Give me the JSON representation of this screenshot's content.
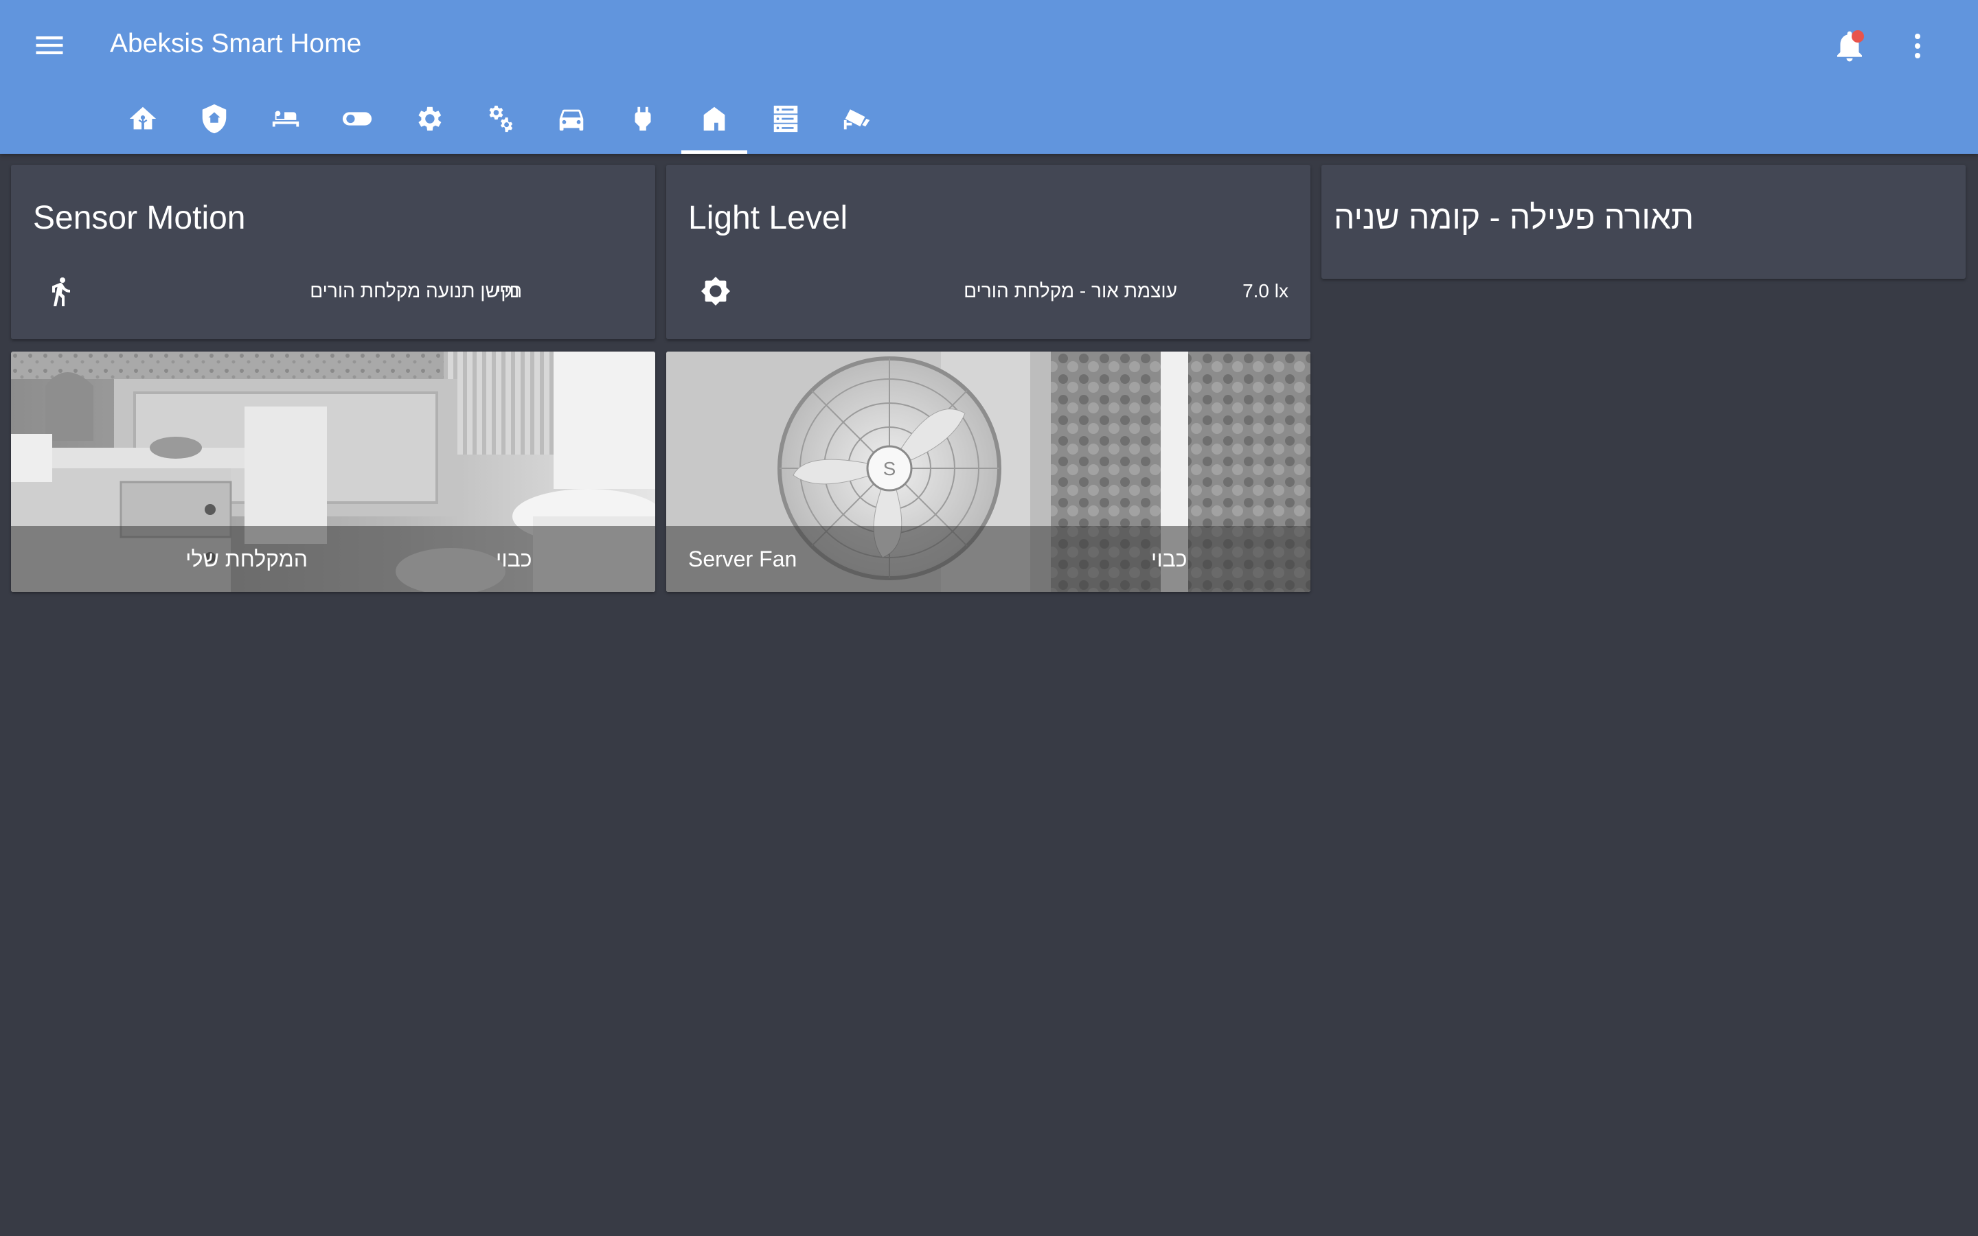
{
  "app": {
    "title": "Abeksis Smart Home",
    "accent_color": "#6195dd",
    "notification_dot_color": "#e8544c",
    "header_icons": [
      "menu-icon",
      "bell-icon",
      "kebab-menu-icon"
    ]
  },
  "tabs": [
    {
      "icon": "home-assistant-icon",
      "active": false
    },
    {
      "icon": "security-shield-icon",
      "active": false
    },
    {
      "icon": "bed-icon",
      "active": false
    },
    {
      "icon": "toggle-switch-icon",
      "active": false
    },
    {
      "icon": "gear-icon",
      "active": false
    },
    {
      "icon": "gears-icon",
      "active": false
    },
    {
      "icon": "car-icon",
      "active": false
    },
    {
      "icon": "power-plug-icon",
      "active": false
    },
    {
      "icon": "floor-plan-icon",
      "active": true
    },
    {
      "icon": "server-icon",
      "active": false
    },
    {
      "icon": "cctv-camera-icon",
      "active": false
    }
  ],
  "cards": {
    "sensor_motion": {
      "title": "Sensor Motion",
      "entity_icon": "walk-icon",
      "entity_name": "חיישן תנועה מקלחת הורים",
      "entity_state": "נקי"
    },
    "light_level": {
      "title": "Light Level",
      "entity_icon": "brightness-icon",
      "entity_name": "עוצמת אור - מקלחת הורים",
      "entity_state": "7.0 lx"
    },
    "lighting": {
      "title": "תאורה פעילה - קומה שניה"
    }
  },
  "picture_cards": [
    {
      "name": "המקלחת שלי",
      "state": "כבוי",
      "image": "bathroom-photo"
    },
    {
      "name": "Server Fan",
      "state": "כבוי",
      "image": "desk-fan-photo"
    }
  ]
}
